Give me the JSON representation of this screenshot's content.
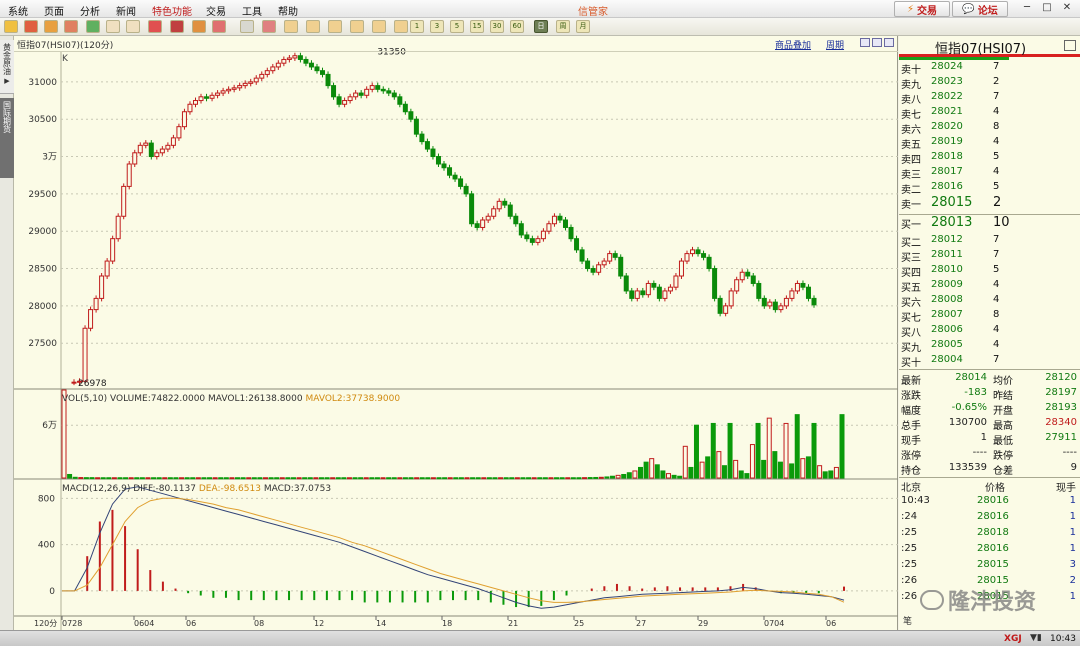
{
  "menu": {
    "items": [
      "系统",
      "页面",
      "分析",
      "新闻",
      "特色功能",
      "交易",
      "工具",
      "帮助"
    ],
    "title": "信管家",
    "trade_button": "交易",
    "forum_button": "论坛"
  },
  "toolbar": {
    "period_buttons": [
      "1",
      "3",
      "5",
      "15",
      "30",
      "60",
      "日",
      "周",
      "月"
    ],
    "active_period": "日"
  },
  "sidebar": {
    "tab1": "黄金原油",
    "tab2": "国际期货"
  },
  "chart_header": {
    "symbol": "恒指07(HSI07)(120分)",
    "overlay_link": "商品叠加",
    "period_link": "周期",
    "k_label": "K"
  },
  "volume_panel": {
    "label": "VOL(5,10)",
    "volume": "VOLUME:74822.0000",
    "mavol1": "MAVOL1:26138.8000",
    "mavol2": "MAVOL2:37738.9000"
  },
  "macd_panel": {
    "label": "MACD(12,26,9)",
    "diff": "DIFF:-80.1137",
    "dea": "DEA:-98.6513",
    "macd": "MACD:37.0753"
  },
  "x_axis": {
    "corner_label": "120分",
    "ticks": [
      "0728",
      "0604",
      "06",
      "08",
      "12",
      "14",
      "18",
      "21",
      "25",
      "27",
      "29",
      "0704",
      "06"
    ]
  },
  "chart_data": [
    {
      "type": "candlestick",
      "ylim": [
        26900,
        31400
      ],
      "yticks": [
        27500,
        28000,
        28500,
        29000,
        29500,
        30000,
        30500,
        31000
      ],
      "ytick_labels": [
        "27500",
        "28000",
        "28500",
        "29000",
        "29500",
        "3万",
        "30500",
        "31000"
      ],
      "annotations": [
        {
          "text": "31350",
          "value": 31350,
          "bar_index": 60
        },
        {
          "text": "26978",
          "value": 26978,
          "bar_index": 0
        }
      ],
      "closes": [
        26978,
        26990,
        27700,
        27950,
        28100,
        28400,
        28600,
        28900,
        29200,
        29600,
        29900,
        30050,
        30150,
        30180,
        30000,
        30050,
        30100,
        30150,
        30250,
        30400,
        30600,
        30700,
        30750,
        30800,
        30780,
        30820,
        30850,
        30880,
        30900,
        30920,
        30950,
        30980,
        31000,
        31050,
        31100,
        31150,
        31200,
        31250,
        31300,
        31320,
        31350,
        31300,
        31250,
        31200,
        31150,
        31100,
        30950,
        30800,
        30700,
        30750,
        30800,
        30850,
        30820,
        30900,
        30950,
        30900,
        30880,
        30850,
        30800,
        30700,
        30600,
        30500,
        30300,
        30200,
        30100,
        30000,
        29900,
        29850,
        29750,
        29700,
        29600,
        29500,
        29100,
        29050,
        29150,
        29200,
        29300,
        29400,
        29350,
        29200,
        29100,
        28950,
        28900,
        28850,
        28900,
        29000,
        29100,
        29200,
        29150,
        29050,
        28900,
        28750,
        28600,
        28500,
        28450,
        28550,
        28600,
        28700,
        28650,
        28400,
        28200,
        28100,
        28200,
        28150,
        28300,
        28250,
        28100,
        28200,
        28250,
        28400,
        28600,
        28700,
        28750,
        28700,
        28650,
        28500,
        28100,
        27900,
        28000,
        28200,
        28350,
        28450,
        28400,
        28300,
        28100,
        28000,
        28050,
        27950,
        28000,
        28100,
        28200,
        28300,
        28250,
        28100,
        28014
      ]
    },
    {
      "type": "bar",
      "title": "VOL(5,10)",
      "ylim": [
        0,
        100000
      ],
      "yticks": [
        60000
      ],
      "ytick_labels": [
        "6万"
      ],
      "values": [
        120000,
        4000,
        800,
        500,
        400,
        400,
        300,
        300,
        300,
        300,
        300,
        300,
        300,
        300,
        300,
        300,
        300,
        300,
        300,
        300,
        300,
        300,
        300,
        300,
        300,
        300,
        300,
        300,
        300,
        300,
        300,
        300,
        300,
        300,
        300,
        300,
        300,
        300,
        300,
        300,
        300,
        300,
        300,
        300,
        300,
        300,
        300,
        300,
        300,
        300,
        300,
        300,
        300,
        300,
        300,
        300,
        300,
        300,
        300,
        300,
        300,
        300,
        300,
        300,
        300,
        300,
        300,
        300,
        300,
        300,
        300,
        300,
        300,
        300,
        300,
        300,
        300,
        300,
        300,
        300,
        300,
        300,
        300,
        300,
        300,
        300,
        300,
        300,
        300,
        300,
        300,
        300,
        300,
        400,
        500,
        600,
        800,
        1200,
        2000,
        3000,
        4000,
        6000,
        8000,
        12000,
        18000,
        22000,
        15000,
        8000,
        5000,
        3000,
        2000,
        36000,
        12000,
        60000,
        18000,
        24000,
        62000,
        30000,
        14000,
        62000,
        20000,
        8000,
        5000,
        38000,
        62000,
        20000,
        68000,
        30000,
        18000,
        62000,
        16000,
        72000,
        22000,
        24000,
        62000,
        14000,
        7000,
        8000,
        12000,
        72000
      ]
    },
    {
      "type": "macd",
      "title": "MACD(12,26,9)",
      "ylim": [
        -200,
        950
      ],
      "yticks": [
        0,
        400,
        800
      ],
      "ytick_labels": [
        "0",
        "400",
        "800"
      ],
      "diff": [
        0,
        0,
        200,
        500,
        750,
        880,
        900,
        870,
        840,
        810,
        780,
        750,
        720,
        690,
        660,
        630,
        600,
        570,
        540,
        510,
        480,
        450,
        420,
        380,
        340,
        300,
        260,
        220,
        180,
        140,
        110,
        80,
        50,
        20,
        -20,
        -60,
        -100,
        -130,
        -150,
        -140,
        -120,
        -100,
        -80,
        -60,
        -50,
        -40,
        -30,
        -25,
        -20,
        -15,
        -10,
        -5,
        0,
        10,
        30,
        20,
        0,
        -15,
        -20,
        -30,
        -40,
        -50,
        -80
      ],
      "dea": [
        0,
        0,
        50,
        200,
        400,
        600,
        720,
        780,
        800,
        800,
        790,
        770,
        750,
        720,
        700,
        670,
        640,
        610,
        580,
        550,
        520,
        490,
        460,
        420,
        390,
        350,
        310,
        270,
        230,
        190,
        150,
        120,
        90,
        60,
        30,
        0,
        -30,
        -60,
        -85,
        -100,
        -100,
        -95,
        -85,
        -75,
        -65,
        -55,
        -45,
        -40,
        -35,
        -30,
        -25,
        -20,
        -15,
        -10,
        0,
        5,
        0,
        -5,
        -10,
        -20,
        -30,
        -50,
        -98
      ],
      "hist": [
        0,
        0,
        300,
        600,
        700,
        560,
        360,
        180,
        80,
        20,
        -20,
        -40,
        -60,
        -60,
        -80,
        -80,
        -80,
        -80,
        -80,
        -80,
        -80,
        -80,
        -80,
        -80,
        -100,
        -100,
        -100,
        -100,
        -100,
        -100,
        -80,
        -80,
        -80,
        -80,
        -100,
        -120,
        -140,
        -140,
        -130,
        -80,
        -40,
        0,
        20,
        40,
        60,
        40,
        20,
        30,
        40,
        30,
        30,
        30,
        30,
        40,
        60,
        30,
        0,
        -20,
        -20,
        -20,
        -20,
        0,
        37
      ]
    }
  ],
  "quote": {
    "title": "恒指07(HSI07)",
    "sells": [
      {
        "label": "卖十",
        "price": "28024",
        "vol": "7"
      },
      {
        "label": "卖九",
        "price": "28023",
        "vol": "2"
      },
      {
        "label": "卖八",
        "price": "28022",
        "vol": "7"
      },
      {
        "label": "卖七",
        "price": "28021",
        "vol": "4"
      },
      {
        "label": "卖六",
        "price": "28020",
        "vol": "8"
      },
      {
        "label": "卖五",
        "price": "28019",
        "vol": "4"
      },
      {
        "label": "卖四",
        "price": "28018",
        "vol": "5"
      },
      {
        "label": "卖三",
        "price": "28017",
        "vol": "4"
      },
      {
        "label": "卖二",
        "price": "28016",
        "vol": "5"
      },
      {
        "label": "卖一",
        "price": "28015",
        "vol": "2"
      }
    ],
    "buys": [
      {
        "label": "买一",
        "price": "28013",
        "vol": "10"
      },
      {
        "label": "买二",
        "price": "28012",
        "vol": "7"
      },
      {
        "label": "买三",
        "price": "28011",
        "vol": "7"
      },
      {
        "label": "买四",
        "price": "28010",
        "vol": "5"
      },
      {
        "label": "买五",
        "price": "28009",
        "vol": "4"
      },
      {
        "label": "买六",
        "price": "28008",
        "vol": "4"
      },
      {
        "label": "买七",
        "price": "28007",
        "vol": "8"
      },
      {
        "label": "买八",
        "price": "28006",
        "vol": "4"
      },
      {
        "label": "买九",
        "price": "28005",
        "vol": "4"
      },
      {
        "label": "买十",
        "price": "28004",
        "vol": "7"
      }
    ],
    "stats": [
      {
        "l1": "最新",
        "v1": "28014",
        "l2": "均价",
        "v2": "28120",
        "c2": "#117a11"
      },
      {
        "l1": "涨跌",
        "v1": "-183",
        "l2": "昨结",
        "v2": "28197",
        "c2": "#117a11"
      },
      {
        "l1": "幅度",
        "v1": "-0.65%",
        "l2": "开盘",
        "v2": "28193",
        "c2": "#117a11"
      },
      {
        "l1": "总手",
        "v1": "130700",
        "l2": "最高",
        "v2": "28340",
        "c2": "#c01c1c"
      },
      {
        "l1": "现手",
        "v1": "1",
        "l2": "最低",
        "v2": "27911",
        "c2": "#117a11"
      },
      {
        "l1": "涨停",
        "v1": "----",
        "l2": "跌停",
        "v2": "----",
        "c2": "#222"
      },
      {
        "l1": "持仓",
        "v1": "133539",
        "l2": "仓差",
        "v2": "9",
        "c2": "#222"
      }
    ],
    "ticks_header": {
      "time": "北京",
      "price": "价格",
      "vol": "现手"
    },
    "ticks": [
      {
        "time": "10:43",
        "price": "28016",
        "vol": "1"
      },
      {
        "time": ":24",
        "price": "28016",
        "vol": "1"
      },
      {
        "time": ":25",
        "price": "28018",
        "vol": "1"
      },
      {
        "time": ":25",
        "price": "28016",
        "vol": "1"
      },
      {
        "time": ":25",
        "price": "28015",
        "vol": "3"
      },
      {
        "time": ":26",
        "price": "28015",
        "vol": "2"
      },
      {
        "time": ":26",
        "price": "28015",
        "vol": "1"
      }
    ],
    "bottom_tab": "笔",
    "watermark": "隆沣投资"
  },
  "status": {
    "brand": "XGJ",
    "time": "10:43"
  }
}
